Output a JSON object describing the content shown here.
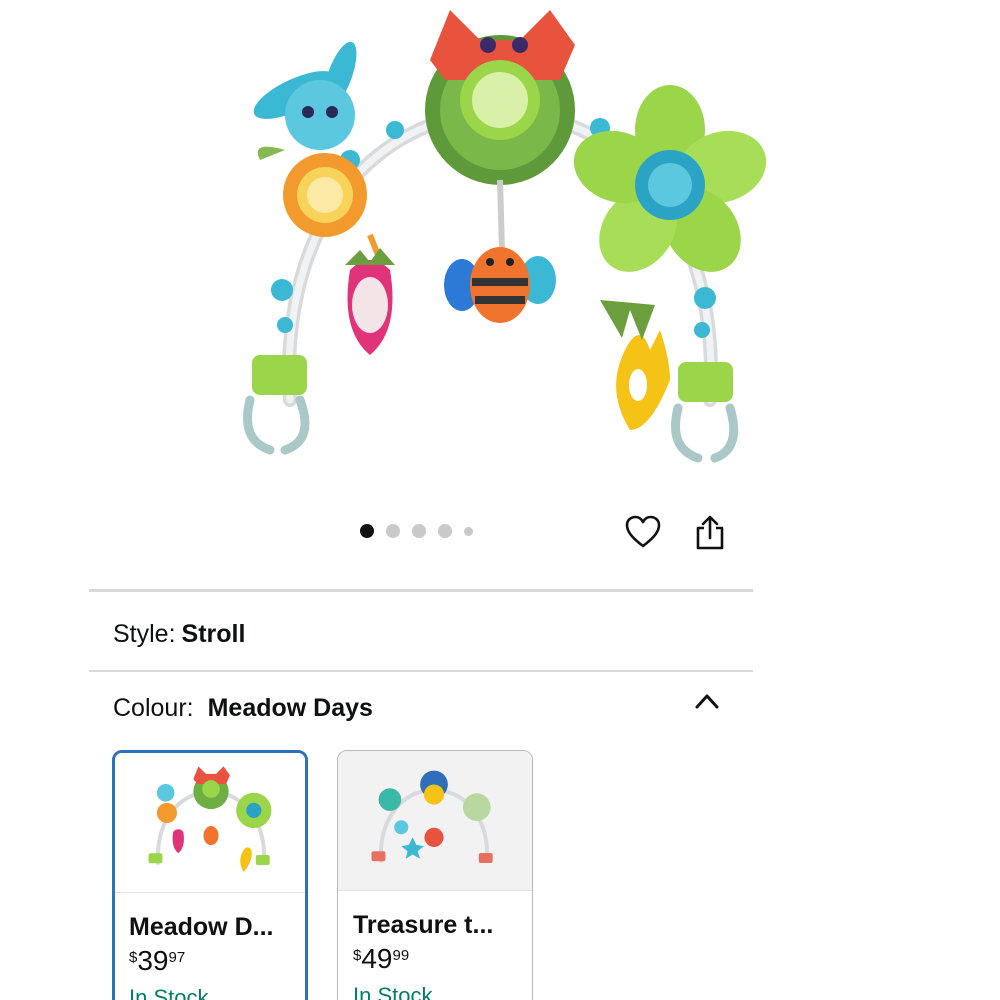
{
  "carousel": {
    "total_images": 5,
    "active_index": 0
  },
  "actions": {
    "wishlist_icon": "heart-icon",
    "share_icon": "share-icon"
  },
  "style": {
    "label": "Style:",
    "value": "Stroll"
  },
  "colour": {
    "label": "Colour:",
    "value": "Meadow Days",
    "toggle_icon": "chevron-up-icon"
  },
  "swatches": [
    {
      "name": "Meadow D...",
      "currency": "$",
      "price_whole": "39",
      "price_fraction": "97",
      "stock": "In Stock",
      "selected": true
    },
    {
      "name": "Treasure t...",
      "currency": "$",
      "price_whole": "49",
      "price_fraction": "99",
      "stock": "In Stock",
      "selected": false
    }
  ],
  "colors": {
    "selected_border": "#2f71b8",
    "stock_green": "#067d62",
    "active_dot": "#111111",
    "inactive_dot": "#c9c9c9"
  }
}
